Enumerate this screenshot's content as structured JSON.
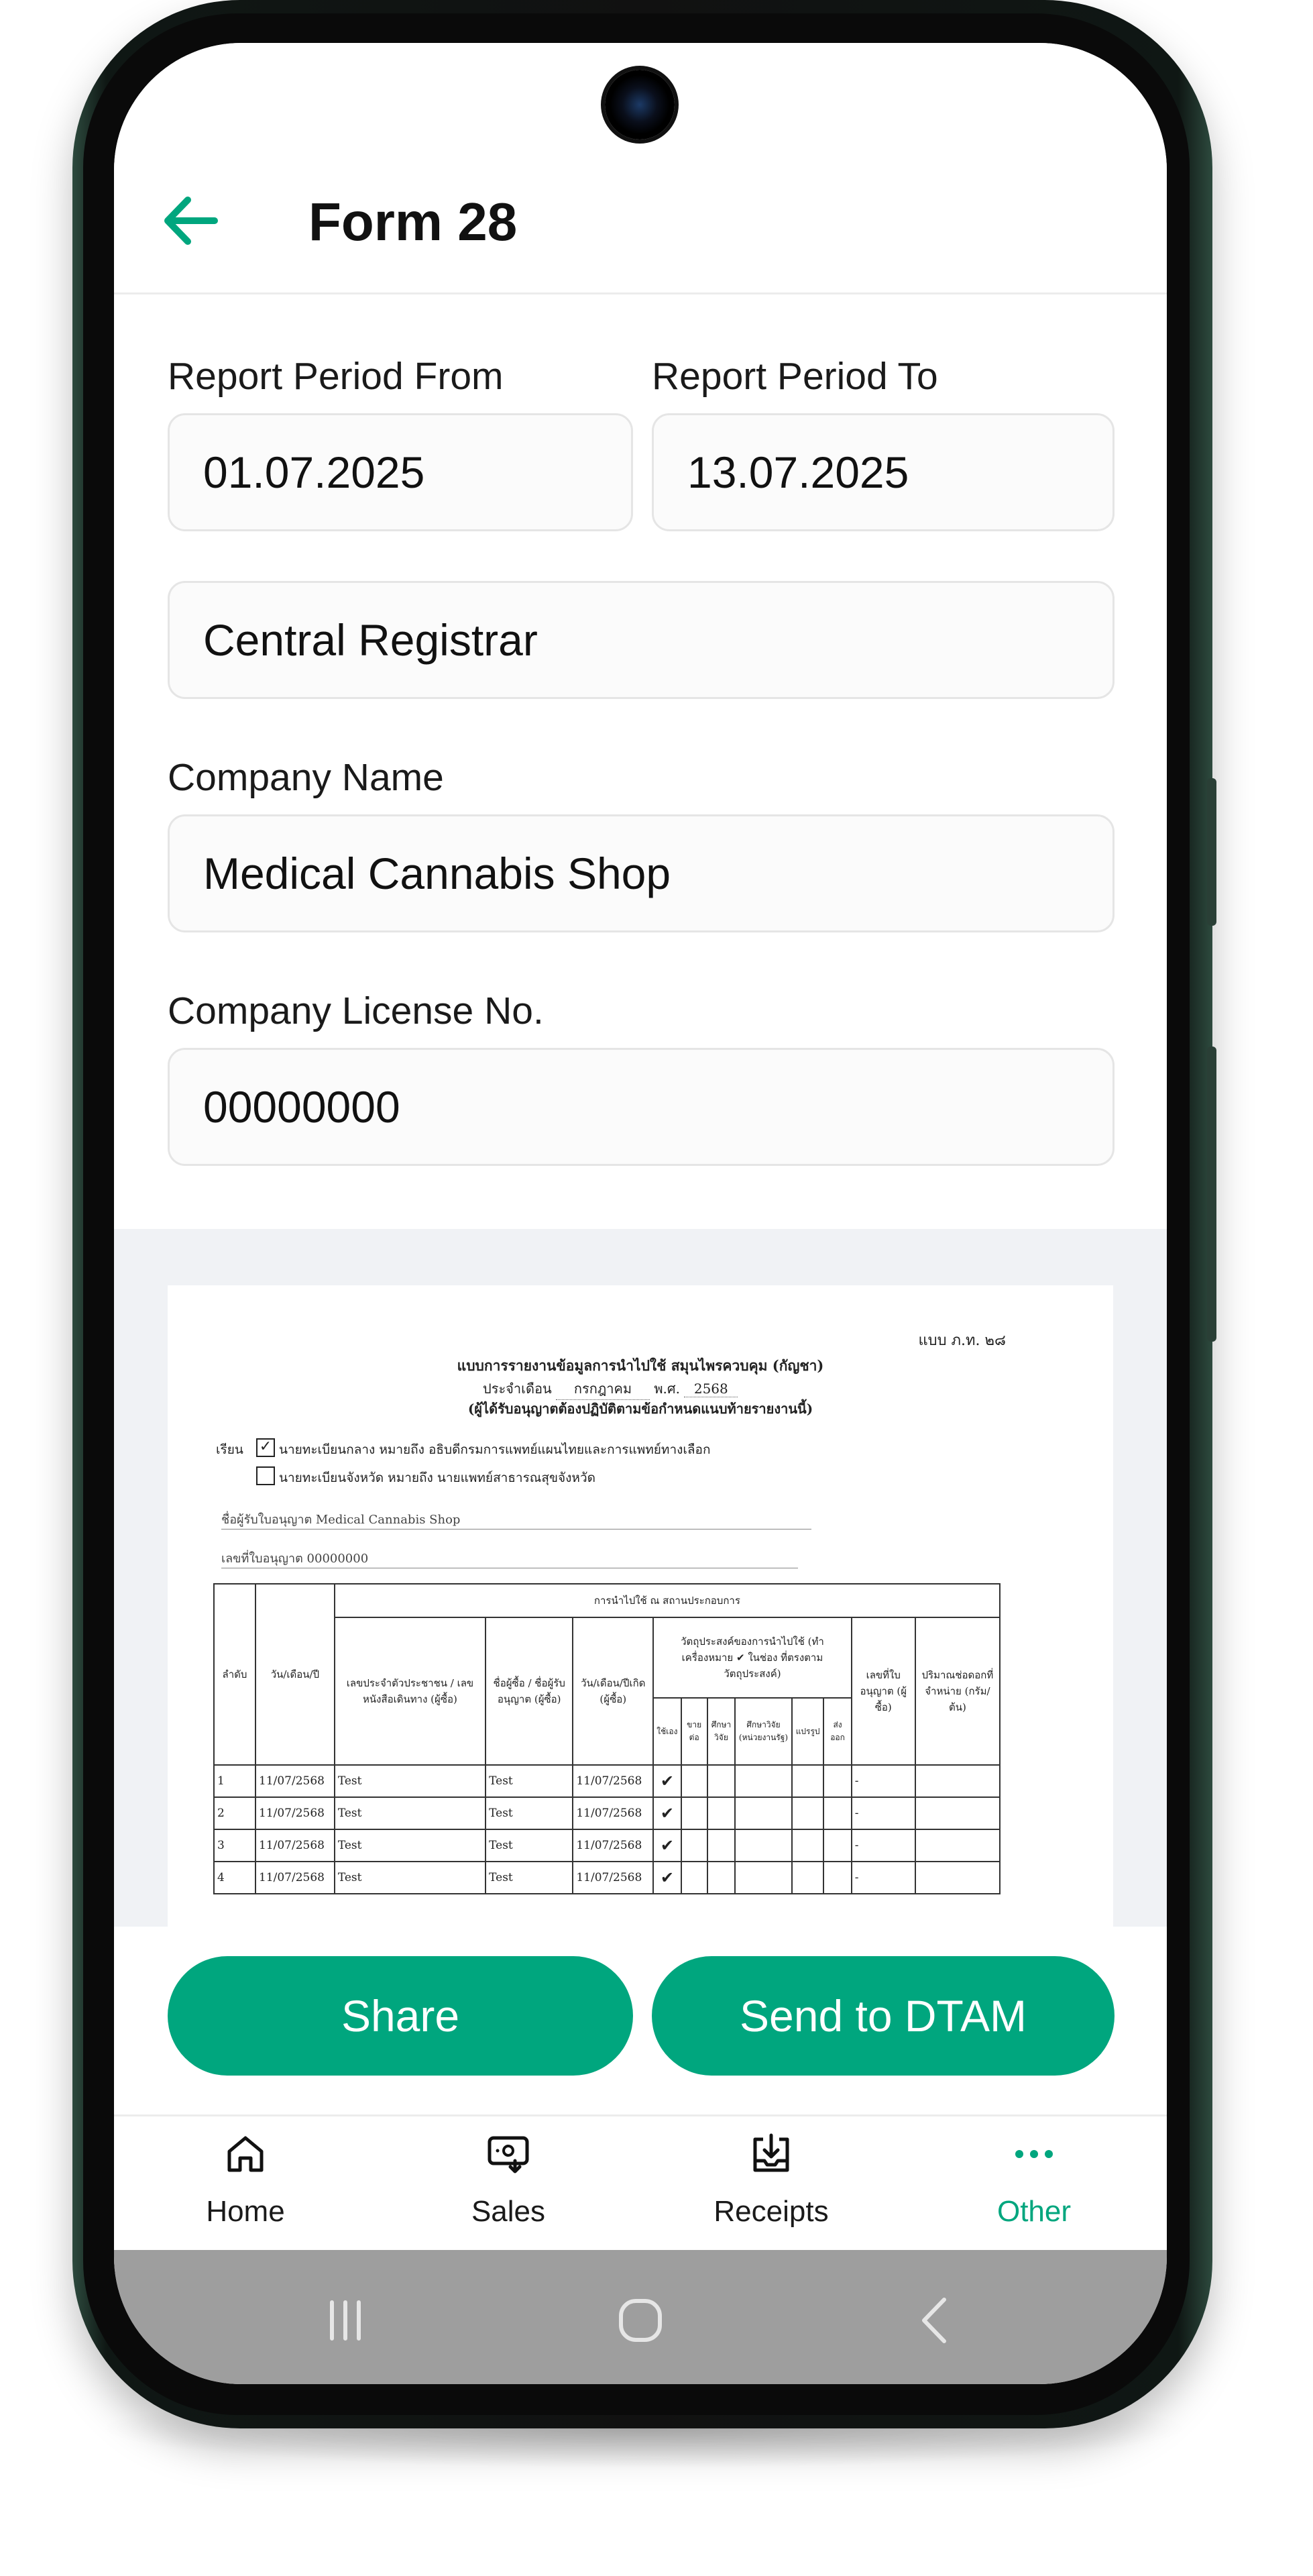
{
  "header": {
    "title": "Form 28"
  },
  "form": {
    "period_from_label": "Report Period From",
    "period_from_value": "01.07.2025",
    "period_to_label": "Report Period To",
    "period_to_value": "13.07.2025",
    "registrar_value": "Central Registrar",
    "company_name_label": "Company Name",
    "company_name_value": "Medical Cannabis Shop",
    "license_label": "Company License No.",
    "license_value": "00000000"
  },
  "document": {
    "form_code": "แบบ ภ.ท. ๒๘",
    "title": "แบบการรายงานข้อมูลการนำไปใช้ สมุนไพรควบคุม (กัญชา)",
    "period_prefix": "ประจำเดือน",
    "month": "กรกฎาคม",
    "year_prefix": "พ.ศ.",
    "year": "2568",
    "instruction": "(ผู้ได้รับอนุญาตต้องปฏิบัติตามข้อกำหนดแนบท้ายรายงานนี้)",
    "to_label": "เรียน",
    "option_1": "นายทะเบียนกลาง หมายถึง อธิบดีกรมการแพทย์แผนไทยและการแพทย์ทางเลือก",
    "option_2": "นายทะเบียนจังหวัด หมายถึง นายแพทย์สาธารณสุขจังหวัด",
    "licensee_line": "ชื่อผู้รับใบอนุญาต Medical Cannabis Shop",
    "license_line": "เลขที่ใบอนุญาต 00000000",
    "headers": {
      "no": "ลำดับ",
      "date": "วัน/เดือน/ปี",
      "usage_group": "การนำไปใช้ ณ สถานประกอบการ",
      "id_no": "เลขประจำตัวประชาชน / เลขหนังสือเดินทาง (ผู้ซื้อ)",
      "buyer_name": "ชื่อผู้ซื้อ / ชื่อผู้รับอนุญาต (ผู้ซื้อ)",
      "expire_date": "วัน/เดือน/ปีเกิด (ผู้ซื้อ)",
      "purpose_group": "วัตถุประสงค์ของการนำไปใช้ (ทำเครื่องหมาย ✔ ในช่อง ที่ตรงตามวัตถุประสงค์)",
      "p1": "ใช้เอง",
      "p2": "ขายต่อ",
      "p3": "ศึกษาวิจัย",
      "p4": "ศึกษาวิจัย (หน่วยงานรัฐ)",
      "p5": "แปรรูป",
      "p6": "ส่งออก",
      "license_no": "เลขที่ใบอนุญาต (ผู้ซื้อ)",
      "quantity": "ปริมาณช่อดอกที่จำหน่าย (กรัม/ต้น)"
    },
    "rows": [
      {
        "no": "1",
        "date": "11/07/2568",
        "id": "Test",
        "name": "Test",
        "dob": "11/07/2568",
        "p1": "✔",
        "license": "-"
      },
      {
        "no": "2",
        "date": "11/07/2568",
        "id": "Test",
        "name": "Test",
        "dob": "11/07/2568",
        "p1": "✔",
        "license": "-"
      },
      {
        "no": "3",
        "date": "11/07/2568",
        "id": "Test",
        "name": "Test",
        "dob": "11/07/2568",
        "p1": "✔",
        "license": "-"
      },
      {
        "no": "4",
        "date": "11/07/2568",
        "id": "Test",
        "name": "Test",
        "dob": "11/07/2568",
        "p1": "✔",
        "license": "-"
      }
    ]
  },
  "actions": {
    "share_label": "Share",
    "send_label": "Send to DTAM"
  },
  "nav": {
    "items": [
      {
        "label": "Home",
        "icon": "home-icon",
        "active": false
      },
      {
        "label": "Sales",
        "icon": "sales-icon",
        "active": false
      },
      {
        "label": "Receipts",
        "icon": "receipts-icon",
        "active": false
      },
      {
        "label": "Other",
        "icon": "more-dots-icon",
        "active": true
      }
    ]
  },
  "colors": {
    "accent": "#00a67e",
    "text": "#111111",
    "field_border": "#e5e5e5",
    "preview_bg": "#f0f2f5"
  }
}
